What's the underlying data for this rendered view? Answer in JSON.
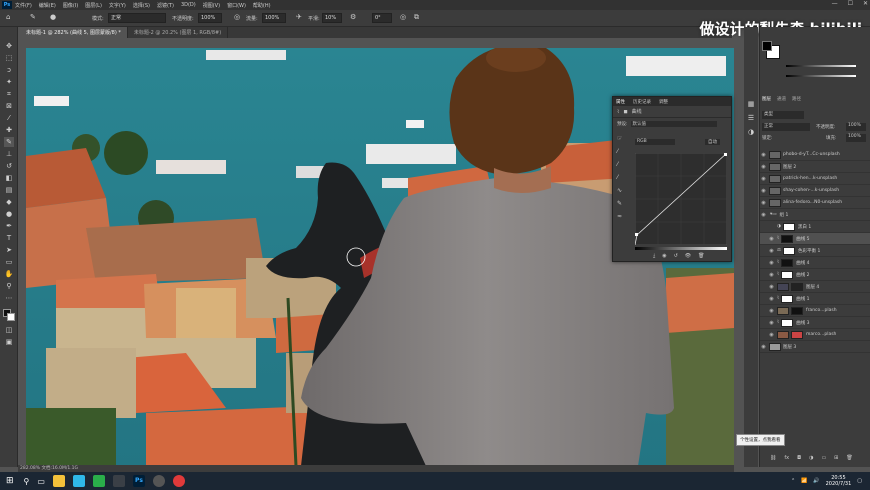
{
  "menu": [
    "文件(F)",
    "编辑(E)",
    "图像(I)",
    "图层(L)",
    "文字(Y)",
    "选择(S)",
    "滤镜(T)",
    "3D(D)",
    "视图(V)",
    "窗口(W)",
    "帮助(H)"
  ],
  "options": {
    "mode_label": "模式:",
    "mode_value": "正常",
    "opacity_label": "不透明度:",
    "opacity_value": "100%",
    "flow_label": "流量:",
    "flow_value": "100%",
    "smooth_label": "平滑:",
    "smooth_value": "10%",
    "angle_value": "0°"
  },
  "tabs": [
    {
      "label": "未标题-1 @ 282% (曲线 5, 图层蒙版/8) *",
      "active": true
    },
    {
      "label": "未标题-2 @ 20.2% (图层 1, RGB/8#)",
      "active": false
    }
  ],
  "watermark": "做设计的梨先森 bilibili",
  "status": "282.08%   文档:16.0M/1.1G",
  "properties": {
    "tabs": [
      "属性",
      "历史记录",
      "调整"
    ],
    "title": "曲线",
    "preset_label": "预设:",
    "preset_value": "默认值",
    "channel": "RGB",
    "auto": "自动"
  },
  "panel_tabs": [
    "图层",
    "通道",
    "路径"
  ],
  "layer_kind": "类型",
  "blend_mode": "正常",
  "opacity_label": "不透明度:",
  "opacity": "100%",
  "lock_label": "锁定:",
  "fill_label": "填充:",
  "fill": "100%",
  "layers": [
    {
      "name": "phobo-d-yT...Cc-unsplash"
    },
    {
      "name": "图层 2"
    },
    {
      "name": "patrick-hen...k-unsplash"
    },
    {
      "name": "shay-cohen-...k-unsplash"
    },
    {
      "name": "alina-fedoro...N0-unsplash"
    },
    {
      "name": "组 1"
    },
    {
      "name": "黑白 1"
    },
    {
      "name": "曲线 5"
    },
    {
      "name": "色彩平衡 1"
    },
    {
      "name": "曲线 4"
    },
    {
      "name": "曲线 2"
    },
    {
      "name": "图层 4"
    },
    {
      "name": "曲线 1"
    },
    {
      "name": "franco...plash"
    },
    {
      "name": "曲线 3"
    },
    {
      "name": "marco...plash"
    },
    {
      "name": "图层 3"
    }
  ],
  "tooltip": "个性设置，点我看看",
  "clock": {
    "time": "20:55",
    "date": "2020/7/31"
  },
  "colors": {
    "accent": "#31a8ff",
    "sea": "#2f7e8c",
    "roof": "#c8623e",
    "shirt": "#8a8a88",
    "hair": "#5a3418",
    "dog": "#1d1f21"
  }
}
